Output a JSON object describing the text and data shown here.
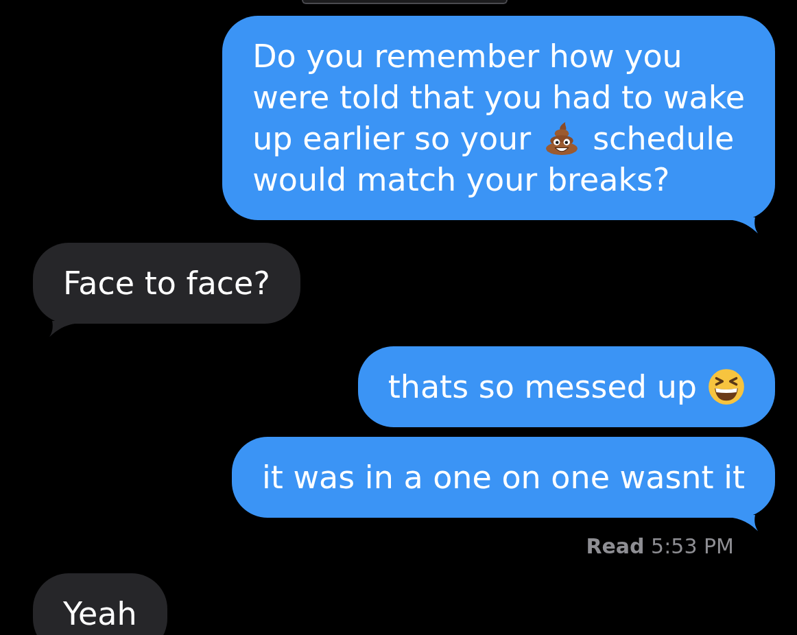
{
  "thread": [
    {
      "kind": "bubble",
      "outgoing": true,
      "tail": true,
      "lines": [
        [
          {
            "kind": "text",
            "text": "Do you remember how you"
          }
        ],
        [
          {
            "kind": "text",
            "text": "were told that you had to wake"
          }
        ],
        [
          {
            "kind": "text",
            "text": "up earlier so your"
          },
          {
            "kind": "poop"
          },
          {
            "kind": "text",
            "text": "schedule"
          }
        ],
        [
          {
            "kind": "text",
            "text": "would match your breaks?"
          }
        ]
      ]
    },
    {
      "kind": "bubble",
      "outgoing": false,
      "tail": true,
      "lines": [
        [
          {
            "kind": "text",
            "text": "Face to face?"
          }
        ]
      ]
    },
    {
      "kind": "bubble",
      "outgoing": true,
      "tail": false,
      "lines": [
        [
          {
            "kind": "text",
            "text": "thats so messed up"
          },
          {
            "kind": "laughing"
          }
        ]
      ]
    },
    {
      "kind": "bubble",
      "outgoing": true,
      "tail": true,
      "lines": [
        [
          {
            "kind": "text",
            "text": "it was in a one on one wasnt it"
          }
        ]
      ]
    },
    {
      "kind": "receipt",
      "text": "**Read** 5:53 PM"
    },
    {
      "kind": "bubble",
      "outgoing": false,
      "tail": false,
      "lines": [
        [
          {
            "kind": "text",
            "text": "Yeah"
          }
        ]
      ]
    }
  ]
}
